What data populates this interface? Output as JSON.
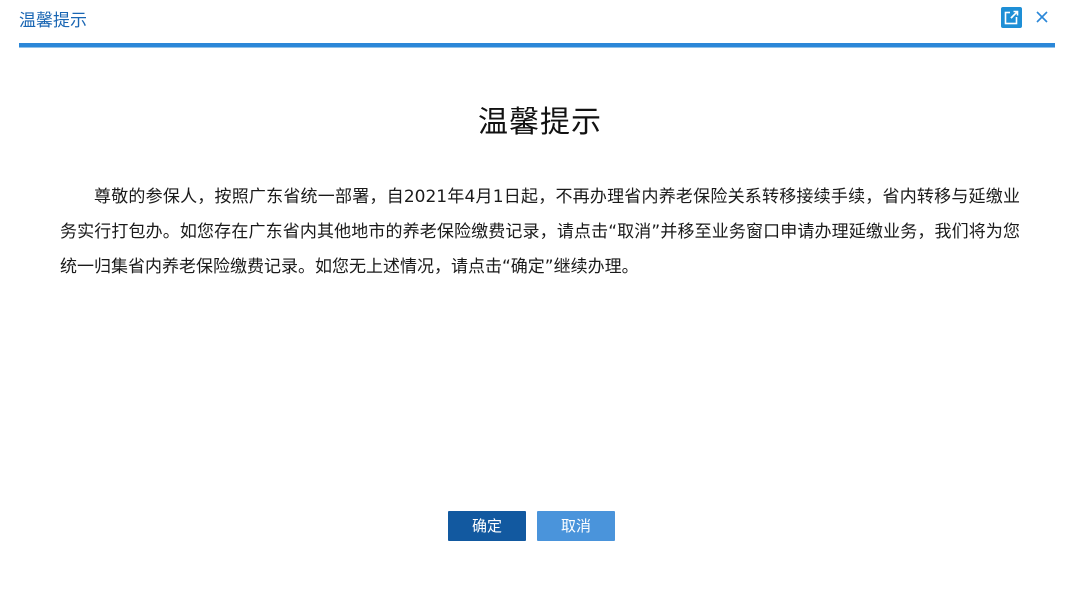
{
  "dialog": {
    "title": "温馨提示",
    "heading": "温馨提示",
    "message": "尊敬的参保人，按照广东省统一部署，自2021年4月1日起，不再办理省内养老保险关系转移接续手续，省内转移与延缴业务实行打包办。如您存在广东省内其他地市的养老保险缴费记录，请点击“取消”并移至业务窗口申请办理延缴业务，我们将为您统一归集省内养老保险缴费记录。如您无上述情况，请点击“确定”继续办理。",
    "confirm_label": "确定",
    "cancel_label": "取消"
  },
  "icons": {
    "popout": "external-window-icon",
    "close": "close-icon"
  },
  "colors": {
    "accent": "#2b87d8",
    "title_text": "#1a66b3",
    "confirm_bg": "#1259a0",
    "cancel_bg": "#4a94db"
  }
}
